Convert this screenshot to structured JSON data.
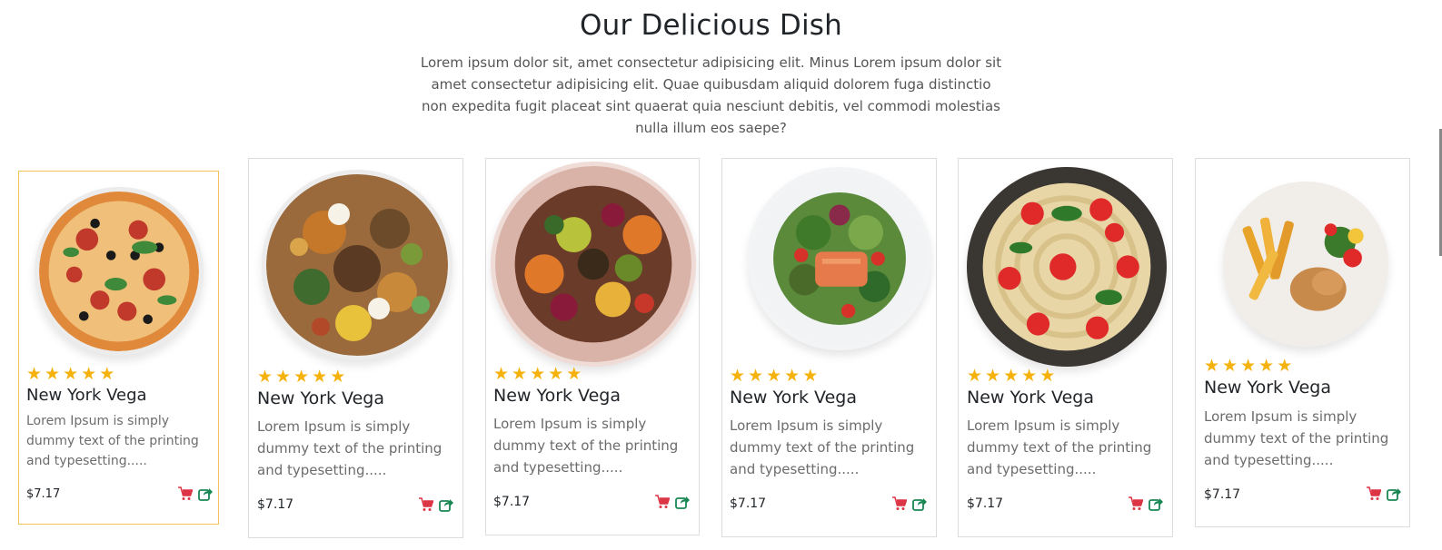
{
  "section": {
    "title": "Our Delicious Dish",
    "description": "Lorem ipsum dolor sit, amet consectetur adipisicing elit. Minus Lorem ipsum dolor sit amet consectetur adipisicing elit. Quae quibusdam aliquid dolorem fuga distinctio non expedita fugit placeat sint quaerat quia nesciunt debitis, vel commodi molestias nulla illum eos saepe?"
  },
  "colors": {
    "star": "#f5b20c",
    "cart_icon": "#dc3545",
    "share_icon": "#198754",
    "active_border": "#f1c25a"
  },
  "icons": {
    "rating": "star-icon",
    "cart": "cart-icon",
    "share": "share-icon"
  },
  "cards": [
    {
      "name": "New York Vega",
      "description": "Lorem Ipsum is simply dummy text of the printing and typesetting.....",
      "price": "$7.17",
      "rating": 5,
      "image": "pizza"
    },
    {
      "name": "New York Vega",
      "description": "Lorem Ipsum is simply dummy text of the printing and typesetting.....",
      "price": "$7.17",
      "rating": 5,
      "image": "ethiopian-platter"
    },
    {
      "name": "New York Vega",
      "description": "Lorem Ipsum is simply dummy text of the printing and typesetting.....",
      "price": "$7.17",
      "rating": 5,
      "image": "injera-platter"
    },
    {
      "name": "New York Vega",
      "description": "Lorem Ipsum is simply dummy text of the printing and typesetting.....",
      "price": "$7.17",
      "rating": 5,
      "image": "salmon-salad"
    },
    {
      "name": "New York Vega",
      "description": "Lorem Ipsum is simply dummy text of the printing and typesetting.....",
      "price": "$7.17",
      "rating": 5,
      "image": "spaghetti"
    },
    {
      "name": "New York Vega",
      "description": "Lorem Ipsum is simply dummy text of the printing and typesetting.....",
      "price": "$7.17",
      "rating": 5,
      "image": "chicken-fries"
    }
  ]
}
